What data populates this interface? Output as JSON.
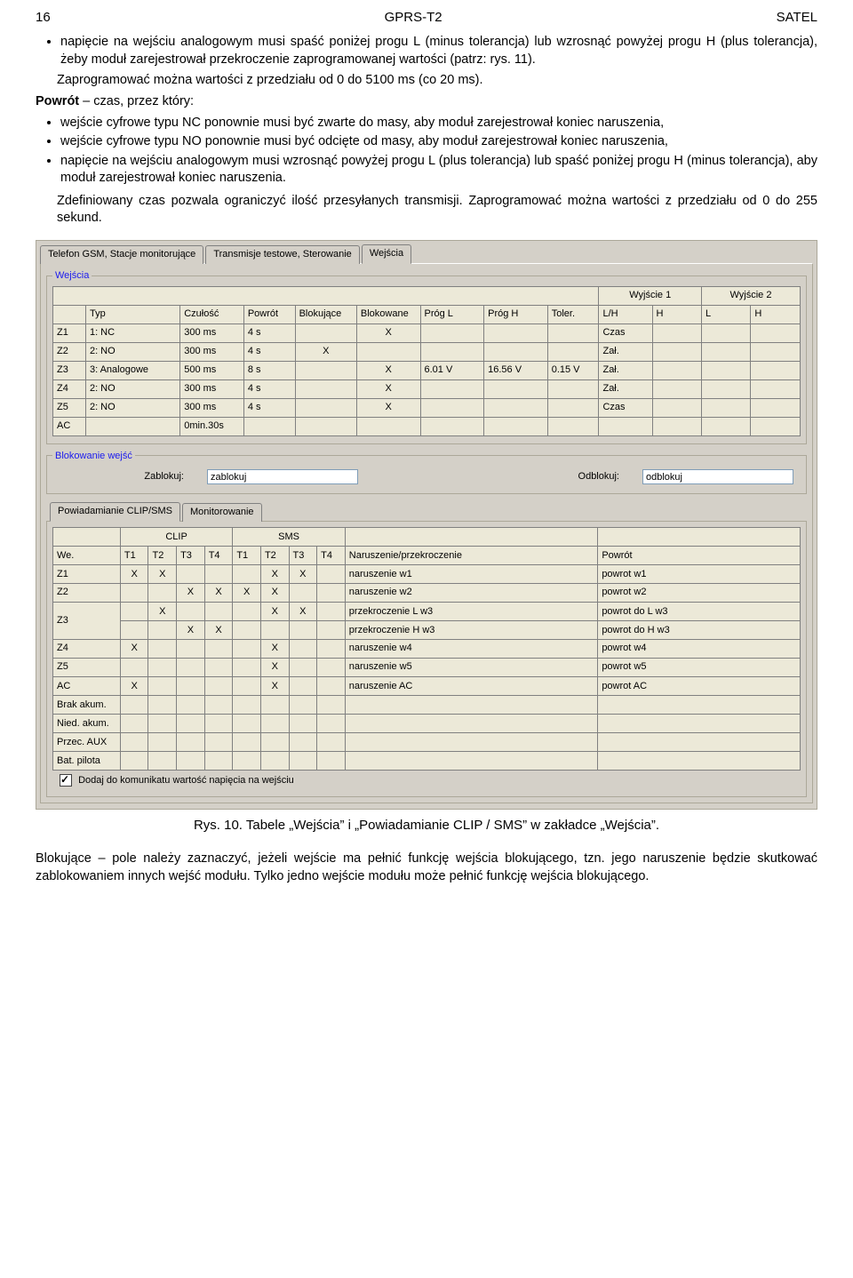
{
  "header": {
    "page": "16",
    "title": "GPRS-T2",
    "brand": "SATEL"
  },
  "text": {
    "b1_li1": "napięcie na wejściu analogowym musi spaść poniżej progu L (minus tolerancja) lub wzrosnąć powyżej progu H (plus tolerancja), żeby moduł zarejestrował przekroczenie zaprogramowanej wartości (patrz: rys. 11).",
    "b1_after": "Zaprogramować można wartości z przedziału od 0 do 5100 ms (co 20 ms).",
    "b2_lead_bold": "Powrót",
    "b2_lead_rest": " – czas, przez który:",
    "b2_li1": "wejście cyfrowe typu NC ponownie musi być zwarte do masy, aby moduł zarejestrował koniec naruszenia,",
    "b2_li2": "wejście cyfrowe typu NO ponownie musi być odcięte od masy, aby moduł zarejestrował koniec naruszenia,",
    "b2_li3": "napięcie na wejściu analogowym musi wzrosnąć powyżej progu L (plus tolerancja) lub spaść poniżej progu H (minus tolerancja), aby moduł zarejestrował koniec naruszenia.",
    "b2_after": "Zdefiniowany czas pozwala ograniczyć ilość przesyłanych transmisji. Zaprogramować można wartości z przedziału od 0 do 255 sekund."
  },
  "ui": {
    "tabs": {
      "t0": "Telefon GSM, Stacje monitorujące",
      "t1": "Transmisje testowe, Sterowanie",
      "t2": "Wejścia"
    },
    "group_inputs_legend": "Wejścia",
    "inputs_table": {
      "hdrs": {
        "typ": "Typ",
        "czulosc": "Czułość",
        "powrot": "Powrót",
        "blokujace": "Blokujące",
        "blokowane": "Blokowane",
        "progl": "Próg L",
        "progh": "Próg H",
        "toler": "Toler.",
        "out1": "Wyjście 1",
        "out2": "Wyjście 2",
        "lh": "L/H",
        "h": "H",
        "l": "L",
        "h2": "H"
      },
      "rows": [
        {
          "z": "Z1",
          "typ": "1: NC",
          "cz": "300 ms",
          "pw": "4 s",
          "bkc": "",
          "bkd": "X",
          "pl": "",
          "ph": "",
          "tl": "",
          "lh": "Czas",
          "h": "",
          "l": "",
          "h2": ""
        },
        {
          "z": "Z2",
          "typ": "2: NO",
          "cz": "300 ms",
          "pw": "4 s",
          "bkc": "X",
          "bkd": "",
          "pl": "",
          "ph": "",
          "tl": "",
          "lh": "Zał.",
          "h": "",
          "l": "",
          "h2": ""
        },
        {
          "z": "Z3",
          "typ": "3: Analogowe",
          "cz": "500 ms",
          "pw": "8 s",
          "bkc": "",
          "bkd": "X",
          "pl": "6.01 V",
          "ph": "16.56 V",
          "tl": "0.15 V",
          "lh": "Zał.",
          "h": "",
          "l": "",
          "h2": ""
        },
        {
          "z": "Z4",
          "typ": "2: NO",
          "cz": "300 ms",
          "pw": "4 s",
          "bkc": "",
          "bkd": "X",
          "pl": "",
          "ph": "",
          "tl": "",
          "lh": "Zał.",
          "h": "",
          "l": "",
          "h2": ""
        },
        {
          "z": "Z5",
          "typ": "2: NO",
          "cz": "300 ms",
          "pw": "4 s",
          "bkc": "",
          "bkd": "X",
          "pl": "",
          "ph": "",
          "tl": "",
          "lh": "Czas",
          "h": "",
          "l": "",
          "h2": ""
        },
        {
          "z": "AC",
          "typ": "",
          "cz": "0min.30s",
          "pw": "",
          "bkc": "",
          "bkd": "",
          "pl": "",
          "ph": "",
          "tl": "",
          "lh": "",
          "h": "",
          "l": "",
          "h2": ""
        }
      ]
    },
    "blok": {
      "legend": "Blokowanie wejść",
      "zablokuj_lbl": "Zablokuj:",
      "zablokuj_val": "zablokuj",
      "odblokuj_lbl": "Odblokuj:",
      "odblokuj_val": "odblokuj"
    },
    "subtabs": {
      "s0": "Powiadamianie CLIP/SMS",
      "s1": "Monitorowanie"
    },
    "sms_table": {
      "hdrs": {
        "we": "We.",
        "clip": "CLIP",
        "sms": "SMS",
        "t1": "T1",
        "t2": "T2",
        "t3": "T3",
        "t4": "T4",
        "nar": "Naruszenie/przekroczenie",
        "pow": "Powrót"
      },
      "rows": [
        {
          "we": "Z1",
          "c": [
            "X",
            "X",
            "",
            "",
            "",
            "X",
            "X",
            ""
          ],
          "nar": "naruszenie w1",
          "pow": "powrot w1",
          "tall": 0
        },
        {
          "we": "Z2",
          "c": [
            "",
            "",
            "X",
            "X",
            "X",
            "X",
            "",
            ""
          ],
          "nar": "naruszenie w2",
          "pow": "powrot w2",
          "tall": 1
        },
        {
          "we": "Z3a",
          "c": [
            "",
            "X",
            "",
            "",
            "",
            "X",
            "X",
            ""
          ],
          "nar": "przekroczenie L w3",
          "pow": "powrot do L w3",
          "tall": 0
        },
        {
          "we": "Z3b",
          "c": [
            "",
            "",
            "X",
            "X",
            "",
            "",
            "",
            ""
          ],
          "nar": "przekroczenie H w3",
          "pow": "powrot do H w3",
          "tall": 0
        },
        {
          "we": "Z4",
          "c": [
            "X",
            "",
            "",
            "",
            "",
            "X",
            "",
            ""
          ],
          "nar": "naruszenie w4",
          "pow": "powrot w4",
          "tall": 1
        },
        {
          "we": "Z5",
          "c": [
            "",
            "",
            "",
            "",
            "",
            "X",
            "",
            ""
          ],
          "nar": "naruszenie w5",
          "pow": "powrot w5",
          "tall": 1
        },
        {
          "we": "AC",
          "c": [
            "X",
            "",
            "",
            "",
            "",
            "X",
            "",
            ""
          ],
          "nar": "naruszenie AC",
          "pow": "powrot AC",
          "tall": 0
        },
        {
          "we": "Brak akum.",
          "c": [
            "",
            "",
            "",
            "",
            "",
            "",
            "",
            ""
          ],
          "nar": "",
          "pow": "",
          "tall": 0
        },
        {
          "we": "Nied. akum.",
          "c": [
            "",
            "",
            "",
            "",
            "",
            "",
            "",
            ""
          ],
          "nar": "",
          "pow": "",
          "tall": 0
        },
        {
          "we": "Przec. AUX",
          "c": [
            "",
            "",
            "",
            "",
            "",
            "",
            "",
            ""
          ],
          "nar": "",
          "pow": "",
          "tall": 0
        },
        {
          "we": "Bat. pilota",
          "c": [
            "",
            "",
            "",
            "",
            "",
            "",
            "",
            ""
          ],
          "nar": "",
          "pow": "",
          "tall": 0
        }
      ],
      "z3_label": "Z3"
    },
    "foot_chk": "Dodaj do komunikatu wartość napięcia na wejściu"
  },
  "caption": "Rys. 10. Tabele „Wejścia” i „Powiadamianie CLIP / SMS” w zakładce „Wejścia”.",
  "bottom": {
    "bold": "Blokujące",
    "rest": " – pole należy zaznaczyć, jeżeli wejście ma pełnić funkcję wejścia blokującego, tzn. jego naruszenie będzie skutkować zablokowaniem innych wejść modułu. Tylko jedno wejście modułu może pełnić funkcję wejścia blokującego."
  }
}
